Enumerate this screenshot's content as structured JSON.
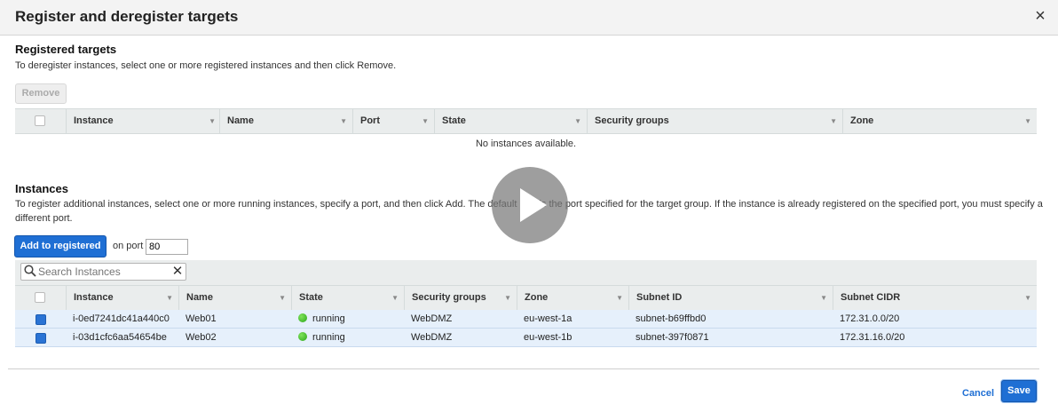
{
  "dialog": {
    "title": "Register and deregister targets",
    "close_icon": "×"
  },
  "registered": {
    "title": "Registered targets",
    "description": "To deregister instances, select one or more registered instances and then click Remove.",
    "remove_label": "Remove",
    "columns": [
      "Instance",
      "Name",
      "Port",
      "State",
      "Security groups",
      "Zone"
    ],
    "empty_text": "No instances available."
  },
  "instances": {
    "title": "Instances",
    "description_line1": "To register additional instances, select one or more running instances, specify a port, and then click Add. The default port is the port specified for the target group. If the instance is already registered on the specified port, you must specify a",
    "description_line2": "different port.",
    "add_label": "Add to registered",
    "port_label": "on port",
    "port_value": "80",
    "search_placeholder": "Search Instances",
    "clear_icon": "✕",
    "columns": [
      "Instance",
      "Name",
      "State",
      "Security groups",
      "Zone",
      "Subnet ID",
      "Subnet CIDR"
    ],
    "rows": [
      {
        "checked": true,
        "instance": "i-0ed7241dc41a440c0",
        "name": "Web01",
        "state": "running",
        "security_group": "WebDMZ",
        "zone": "eu-west-1a",
        "subnet_id": "subnet-b69ffbd0",
        "subnet_cidr": "172.31.0.0/20"
      },
      {
        "checked": true,
        "instance": "i-03d1cfc6aa54654be",
        "name": "Web02",
        "state": "running",
        "security_group": "WebDMZ",
        "zone": "eu-west-1b",
        "subnet_id": "subnet-397f0871",
        "subnet_cidr": "172.31.16.0/20"
      }
    ]
  },
  "footer": {
    "cancel_label": "Cancel",
    "save_label": "Save"
  },
  "colors": {
    "primary": "#1f6fd4",
    "row_selected": "#e6f0fb",
    "running": "#2aa61a"
  }
}
